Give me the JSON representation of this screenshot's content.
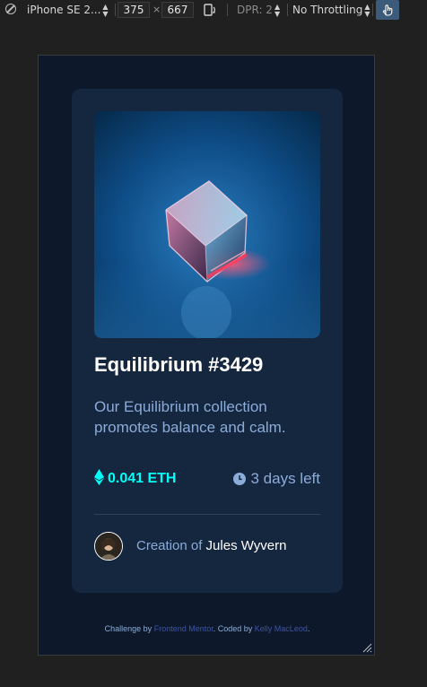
{
  "toolbar": {
    "device": "iPhone SE 2...",
    "width": "375",
    "times": "×",
    "height": "667",
    "dpr": "DPR: 2",
    "throttling": "No Throttling"
  },
  "card": {
    "title": "Equilibrium #3429",
    "description": "Our Equilibrium collection promotes balance and calm.",
    "price": "0.041 ETH",
    "time_left": "3 days left",
    "creation_prefix": "Creation of",
    "creator_name": "Jules Wyvern"
  },
  "attribution": {
    "prefix": "Challenge by",
    "link1": "Frontend Mentor",
    "middle": ". Coded by",
    "link2": "Kelly MacLeod",
    "suffix": "."
  },
  "colors": {
    "page_bg": "#0d192b",
    "card_bg": "#15263f",
    "cyan": "#00fff8",
    "soft_blue": "#8bacd9",
    "white": "#ffffff"
  },
  "icons": [
    "no-touch-icon",
    "rotate-icon",
    "touch-icon",
    "ethereum-icon",
    "clock-icon",
    "resize-handle-icon"
  ]
}
